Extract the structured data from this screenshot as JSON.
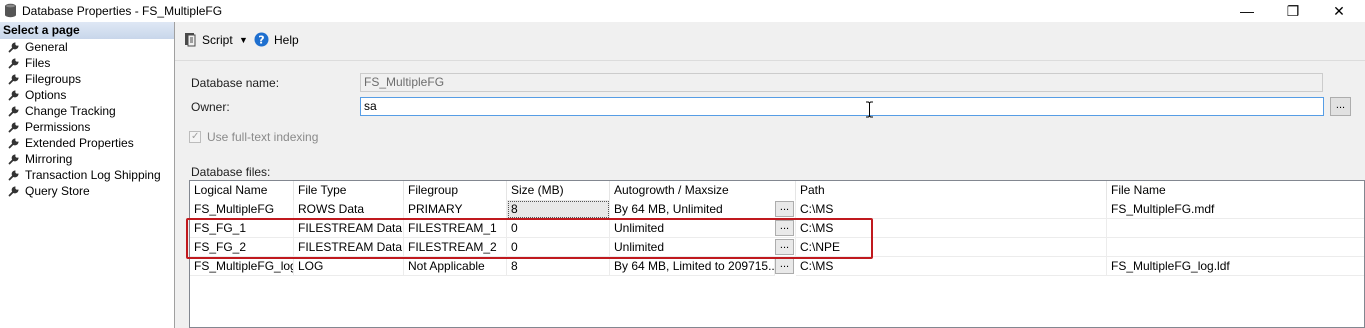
{
  "window": {
    "title": "Database Properties - FS_MultipleFG",
    "minimize": "—",
    "maximize": "❐",
    "close": "✕"
  },
  "sidebar": {
    "header": "Select a page",
    "items": [
      {
        "label": "General"
      },
      {
        "label": "Files"
      },
      {
        "label": "Filegroups"
      },
      {
        "label": "Options"
      },
      {
        "label": "Change Tracking"
      },
      {
        "label": "Permissions"
      },
      {
        "label": "Extended Properties"
      },
      {
        "label": "Mirroring"
      },
      {
        "label": "Transaction Log Shipping"
      },
      {
        "label": "Query Store"
      }
    ]
  },
  "toolbar": {
    "script_label": "Script",
    "script_arrow": "▼",
    "help_label": "Help"
  },
  "form": {
    "db_name_label": "Database name:",
    "db_name_value": "FS_MultipleFG",
    "owner_label": "Owner:",
    "owner_value": "sa",
    "fulltext_label": "Use full-text indexing",
    "files_label": "Database files:",
    "browse_label": "..."
  },
  "files_table": {
    "headers": [
      "Logical Name",
      "File Type",
      "Filegroup",
      "Size (MB)",
      "Autogrowth / Maxsize",
      "Path",
      "File Name"
    ],
    "rows": [
      [
        "FS_MultipleFG",
        "ROWS Data",
        "PRIMARY",
        "8",
        "By 64 MB, Unlimited",
        "C:\\MS",
        "FS_MultipleFG.mdf"
      ],
      [
        "FS_FG_1",
        "FILESTREAM Data",
        "FILESTREAM_1",
        "0",
        "Unlimited",
        "C:\\MS",
        ""
      ],
      [
        "FS_FG_2",
        "FILESTREAM Data",
        "FILESTREAM_2",
        "0",
        "Unlimited",
        "C:\\NPE",
        ""
      ],
      [
        "FS_MultipleFG_log",
        "LOG",
        "Not Applicable",
        "8",
        "By 64 MB, Limited to 209715...",
        "C:\\MS",
        "FS_MultipleFG_log.ldf"
      ]
    ],
    "cell_button": "..."
  },
  "colors": {
    "highlight": "#c0191e",
    "accent": "#569de5"
  }
}
